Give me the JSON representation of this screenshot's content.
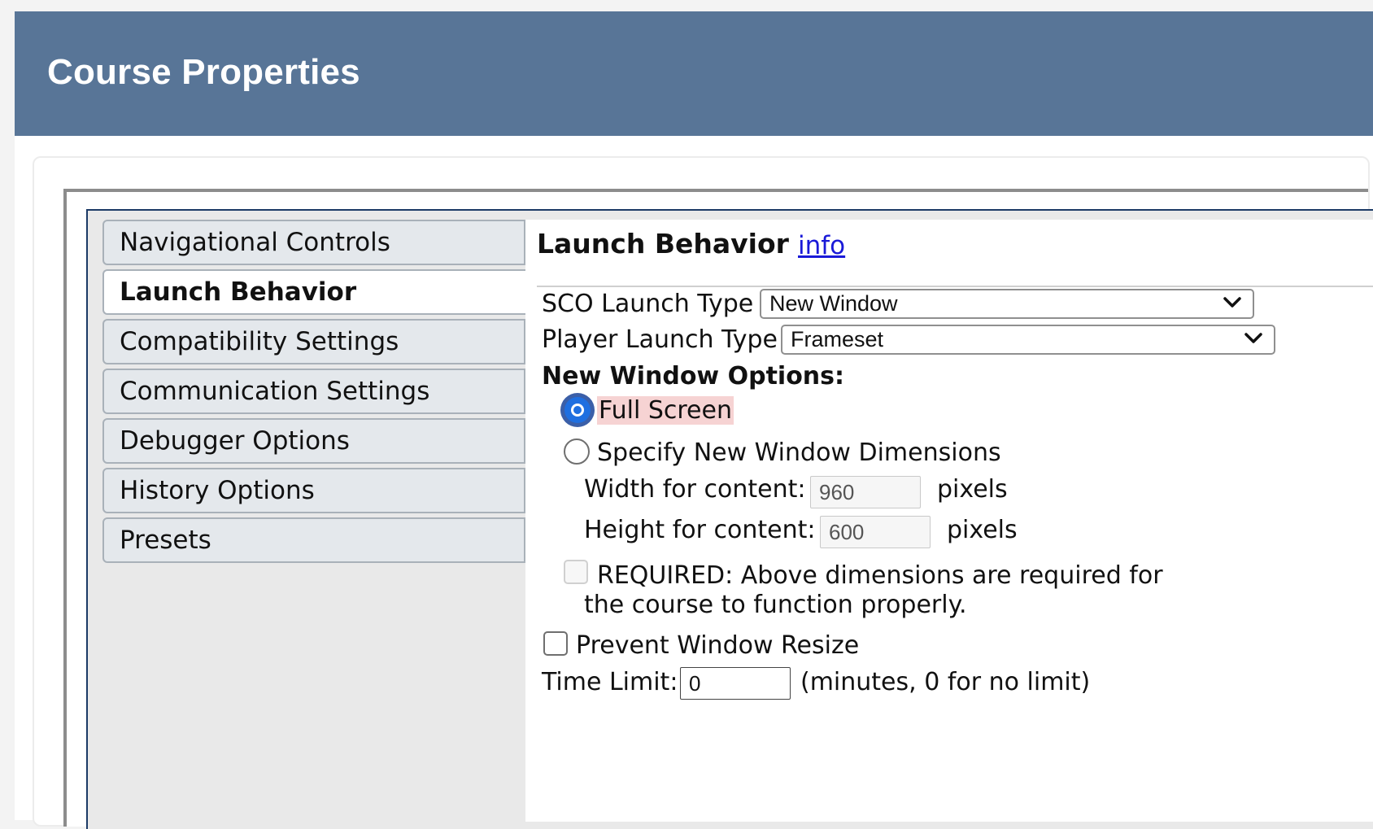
{
  "window": {
    "title": "Course Properties"
  },
  "sidebar": {
    "items": [
      {
        "label": "Navigational Controls",
        "active": false
      },
      {
        "label": "Launch Behavior",
        "active": true
      },
      {
        "label": "Compatibility Settings",
        "active": false
      },
      {
        "label": "Communication Settings",
        "active": false
      },
      {
        "label": "Debugger Options",
        "active": false
      },
      {
        "label": "History Options",
        "active": false
      },
      {
        "label": "Presets",
        "active": false
      }
    ]
  },
  "main": {
    "title": "Launch Behavior",
    "info_link": "info",
    "sco_launch_type": {
      "label": "SCO Launch Type",
      "value": "New Window"
    },
    "player_launch_type": {
      "label": "Player Launch Type",
      "value": "Frameset"
    },
    "new_window_options": {
      "title": "New Window Options:",
      "full_screen": {
        "label": "Full Screen",
        "checked": true
      },
      "specify_dimensions": {
        "label": "Specify New Window Dimensions",
        "checked": false
      },
      "width": {
        "label": "Width for content:",
        "value": "960",
        "unit": "pixels"
      },
      "height": {
        "label": "Height for content:",
        "value": "600",
        "unit": "pixels"
      },
      "required": {
        "line1": "REQUIRED: Above dimensions are required for",
        "line2": "the course to function properly.",
        "checked": false
      }
    },
    "prevent_resize": {
      "label": "Prevent Window Resize",
      "checked": false
    },
    "time_limit": {
      "label": "Time Limit:",
      "value": "0",
      "note": "(minutes, 0 for no limit)"
    }
  },
  "icons": {
    "select_arrow": "chevron-down-icon"
  },
  "colors": {
    "title_bar": "#587597",
    "link": "#1a1ad8",
    "radio_selected": "#1f6fe0",
    "highlight": "#f6d3d3"
  }
}
